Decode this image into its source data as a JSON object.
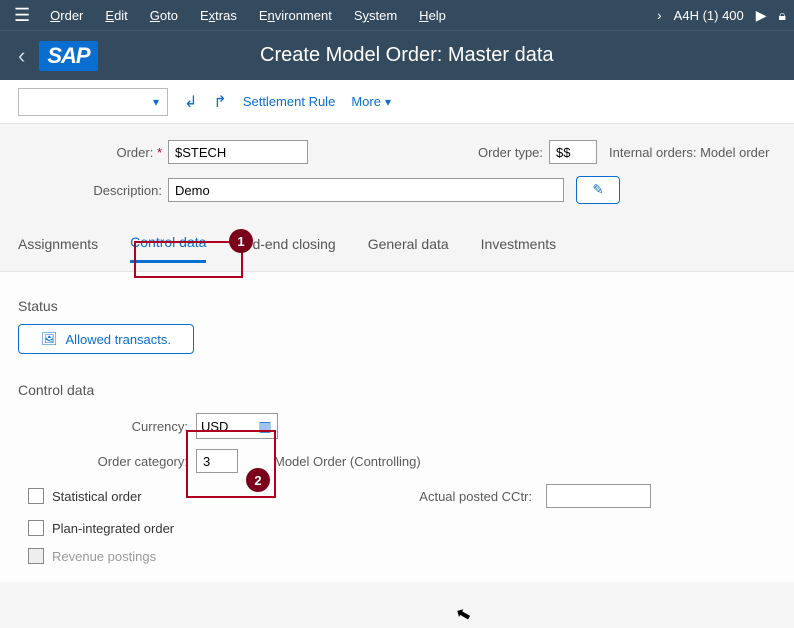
{
  "menu": {
    "items": [
      "Order",
      "Edit",
      "Goto",
      "Extras",
      "Environment",
      "System",
      "Help"
    ],
    "system": "A4H (1) 400"
  },
  "title": "Create Model Order: Master data",
  "logo": "SAP",
  "toolbar": {
    "settlement": "Settlement Rule",
    "more": "More"
  },
  "header": {
    "order_label": "Order:",
    "order_value": "$STECH",
    "order_type_label": "Order type:",
    "order_type_value": "$$",
    "order_type_desc": "Internal orders: Model order",
    "description_label": "Description:",
    "description_value": "Demo"
  },
  "tabs": [
    "Assignments",
    "Control data",
    "Prd-end closing",
    "General data",
    "Investments"
  ],
  "active_tab": 1,
  "status": {
    "section": "Status",
    "allowed_btn": "Allowed transacts."
  },
  "control": {
    "section": "Control data",
    "currency_label": "Currency:",
    "currency_value": "USD",
    "category_label": "Order category:",
    "category_value": "3",
    "category_desc": "Model Order (Controlling)",
    "statistical": "Statistical order",
    "posted_label": "Actual posted CCtr:",
    "posted_value": "",
    "plan_integrated": "Plan-integrated order",
    "revenue_postings": "Revenue postings"
  },
  "callouts": {
    "one": "1",
    "two": "2"
  }
}
